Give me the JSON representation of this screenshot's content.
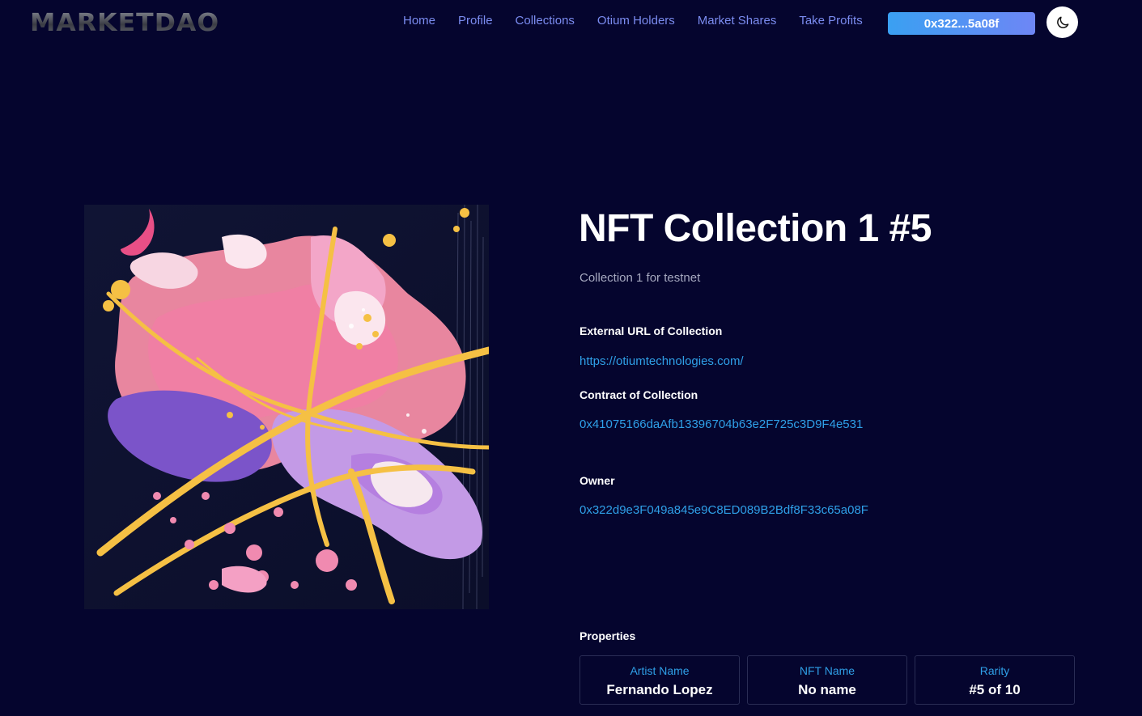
{
  "header": {
    "logo_text": "MARKETDAO",
    "nav": [
      {
        "label": "Home"
      },
      {
        "label": "Profile"
      },
      {
        "label": "Collections"
      },
      {
        "label": "Otium Holders"
      },
      {
        "label": "Market Shares"
      },
      {
        "label": "Take Profits"
      }
    ],
    "wallet_label": "0x322...5a08f",
    "theme_icon": "moon-icon"
  },
  "nft": {
    "title": "NFT Collection 1 #5",
    "description": "Collection 1 for testnet",
    "external_url_label": "External URL of Collection",
    "external_url": "https://otiumtechnologies.com/",
    "contract_label": "Contract of Collection",
    "contract": "0x41075166daAfb13396704b63e2F725c3D9F4e531",
    "owner_label": "Owner",
    "owner": "0x322d9e3F049a845e9C8ED089B2Bdf8F33c65a08F",
    "properties_label": "Properties",
    "properties": [
      {
        "type": "Artist Name",
        "value": "Fernando Lopez"
      },
      {
        "type": "NFT Name",
        "value": "No name"
      },
      {
        "type": "Rarity",
        "value": "#5 of 10"
      }
    ]
  },
  "colors": {
    "background": "#05052e",
    "nav_link": "#7b8cf0",
    "accent_link": "#2fa0e8",
    "wallet_gradient_start": "#3aa0f2",
    "wallet_gradient_end": "#6e86f5"
  }
}
